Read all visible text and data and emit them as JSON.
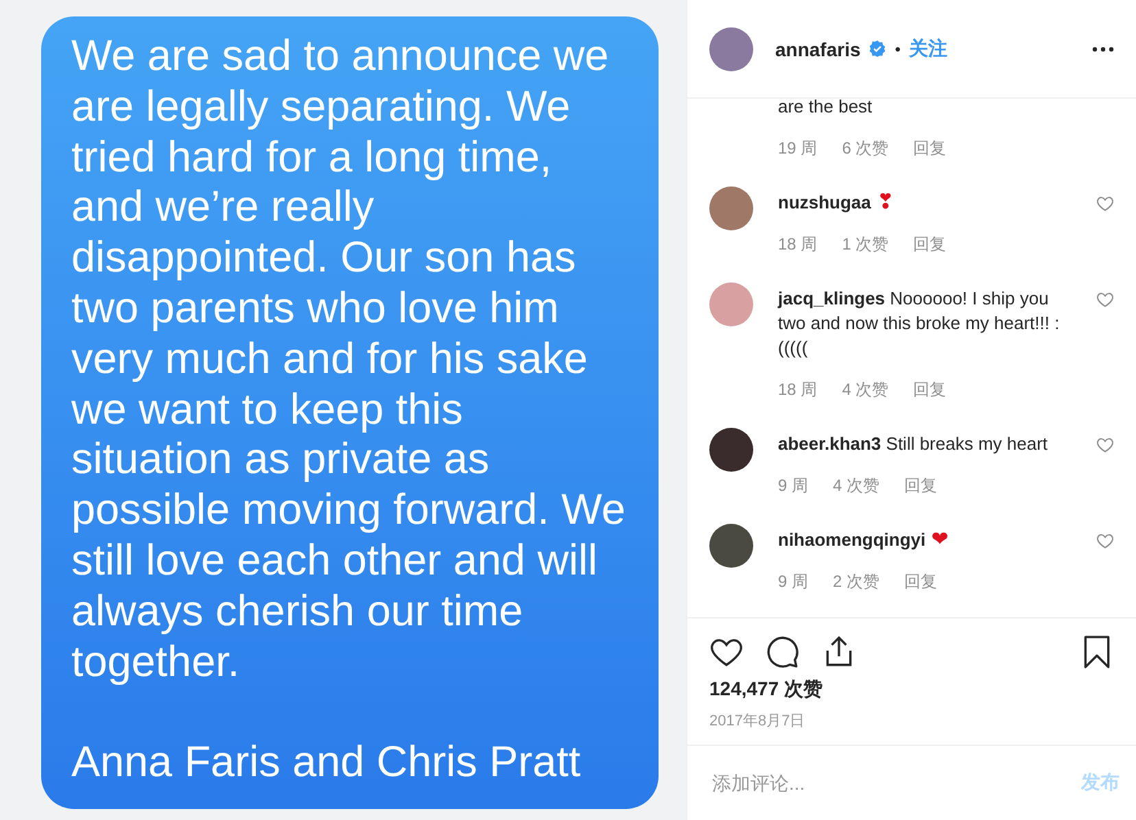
{
  "message": {
    "paragraphs": [
      "We are sad to announce we are legally separating. We tried hard for a long time, and we’re really disappointed.  Our son has two parents who love him very much and for his sake we want to keep this situation as private as possible moving forward. We still love each other and will always cherish our time together.",
      "Anna Faris and Chris Pratt"
    ]
  },
  "header": {
    "username": "annafaris",
    "verified": true,
    "separator": "•",
    "follow": "关注"
  },
  "comments": [
    {
      "kind": "partial",
      "text": "are the best",
      "age": "19 周",
      "likes": "6 次赞",
      "reply": "回复"
    },
    {
      "kind": "full",
      "username": "nuzshugaa",
      "emoji": "❣",
      "age": "18 周",
      "likes": "1 次赞",
      "reply": "回复"
    },
    {
      "kind": "full",
      "username": "jacq_klinges",
      "text": "Noooooo! I ship you two and now this broke my heart!!! :(((((",
      "age": "18 周",
      "likes": "4 次赞",
      "reply": "回复"
    },
    {
      "kind": "full",
      "username": "abeer.khan3",
      "text": "Still breaks my heart",
      "age": "9 周",
      "likes": "4 次赞",
      "reply": "回复"
    },
    {
      "kind": "full",
      "username": "nihaomengqingyi",
      "emoji": "❤",
      "age": "9 周",
      "likes": "2 次赞",
      "reply": "回复"
    }
  ],
  "likes": "124,477 次赞",
  "date": "2017年8月7日",
  "comment_box": {
    "placeholder": "添加评论...",
    "post_button": "发布",
    "post_disabled": true
  }
}
